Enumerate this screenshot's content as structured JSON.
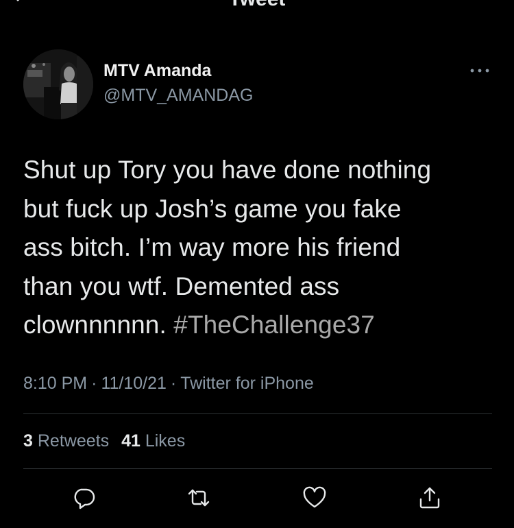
{
  "header": {
    "title": "Tweet",
    "back_icon": "back-arrow-icon"
  },
  "author": {
    "display_name": "MTV Amanda",
    "handle": "@MTV_AMANDAG",
    "avatar_icon": "profile-photo"
  },
  "tweet": {
    "lines": [
      "Shut up Tory you have done nothing",
      "but fuck up Josh’s game you fake",
      "ass bitch. I’m way more his friend",
      "than you wtf. Demented ass"
    ],
    "last_line_text": "clownnnnnn.",
    "hashtag": "#TheChallenge37"
  },
  "meta": {
    "time": "8:10 PM",
    "separator": "·",
    "date": "11/10/21",
    "source": "Twitter for iPhone"
  },
  "stats": {
    "retweets_count": "3",
    "retweets_label": "Retweets",
    "likes_count": "41",
    "likes_label": "Likes"
  },
  "actions": {
    "reply_icon": "reply-icon",
    "retweet_icon": "retweet-icon",
    "like_icon": "heart-icon",
    "share_icon": "share-icon"
  },
  "colors": {
    "background": "#000000",
    "text": "#e7e9ea",
    "secondary": "#8b98a5",
    "divider": "#2f3336"
  }
}
